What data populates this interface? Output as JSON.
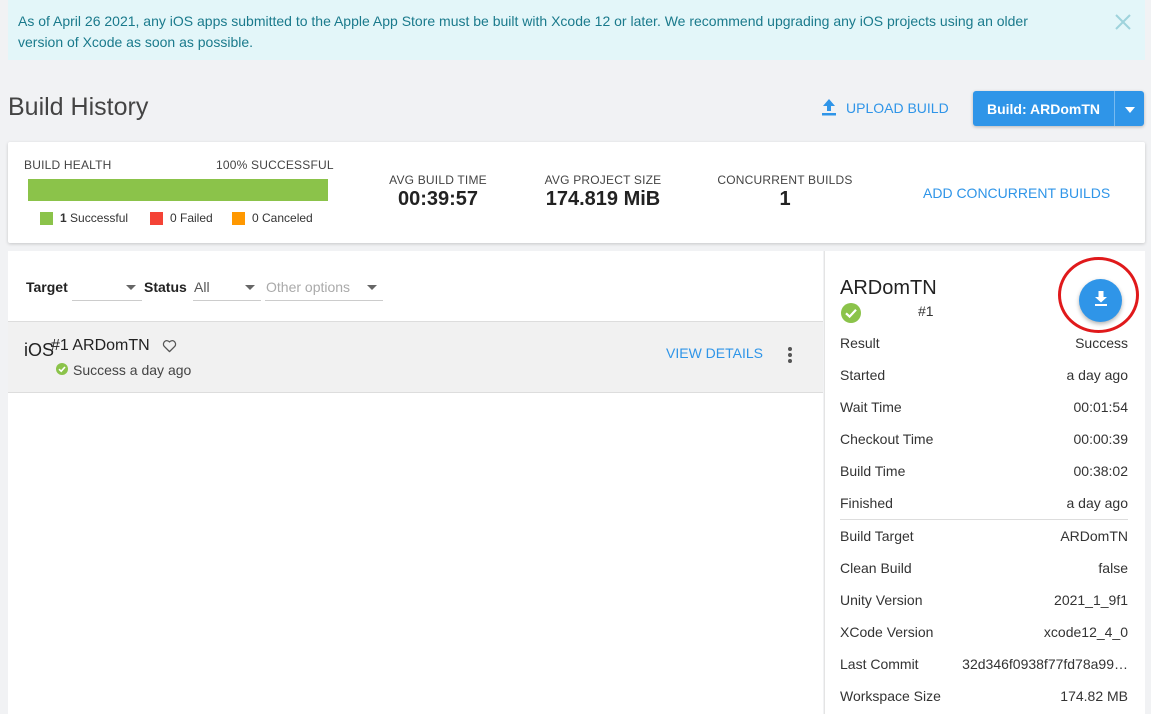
{
  "banner": {
    "text": "As of April 26 2021, any iOS apps submitted to the Apple App Store must be built with Xcode 12 or later. We recommend upgrading any iOS projects using an older version of Xcode as soon as possible.",
    "close_icon": "close-icon"
  },
  "header": {
    "title": "Build History",
    "upload_label": "UPLOAD BUILD",
    "build_label": "Build: ARDomTN"
  },
  "stats": {
    "health_label": "BUILD HEALTH",
    "health_pct_label": "100% SUCCESSFUL",
    "health_fraction": 1.0,
    "successful_count": "1",
    "successful_label": "Successful",
    "failed_label": "0 Failed",
    "canceled_label": "0 Canceled",
    "avg_build_time_label": "AVG BUILD TIME",
    "avg_build_time": "00:39:57",
    "avg_project_size_label": "AVG PROJECT SIZE",
    "avg_project_size": "174.819 MiB",
    "concurrent_label": "CONCURRENT BUILDS",
    "concurrent_value": "1",
    "add_concurrent": "ADD CONCURRENT BUILDS",
    "colors": {
      "success": "#8bc34a",
      "failed": "#f44336",
      "canceled": "#ff9800"
    }
  },
  "filters": {
    "target_label": "Target",
    "target_value": "",
    "status_label": "Status",
    "status_value": "All",
    "other_placeholder": "Other options"
  },
  "builds": [
    {
      "platform": "iOS",
      "title": "#1 ARDomTN",
      "status": "Success a day ago",
      "view_details": "VIEW DETAILS"
    }
  ],
  "detail": {
    "name": "ARDomTN",
    "number": "#1",
    "rows": [
      {
        "label": "Result",
        "value": "Success"
      },
      {
        "label": "Started",
        "value": "a day ago"
      },
      {
        "label": "Wait Time",
        "value": "00:01:54"
      },
      {
        "label": "Checkout Time",
        "value": "00:00:39"
      },
      {
        "label": "Build Time",
        "value": "00:38:02"
      },
      {
        "label": "Finished",
        "value": "a day ago"
      },
      {
        "label": "Build Target",
        "value": "ARDomTN"
      },
      {
        "label": "Clean Build",
        "value": "false"
      },
      {
        "label": "Unity Version",
        "value": "2021_1_9f1"
      },
      {
        "label": "XCode Version",
        "value": "xcode12_4_0"
      },
      {
        "label": "Last Commit",
        "value": "32d346f0938f77fd78a99…"
      },
      {
        "label": "Workspace Size",
        "value": "174.82 MB"
      }
    ]
  }
}
